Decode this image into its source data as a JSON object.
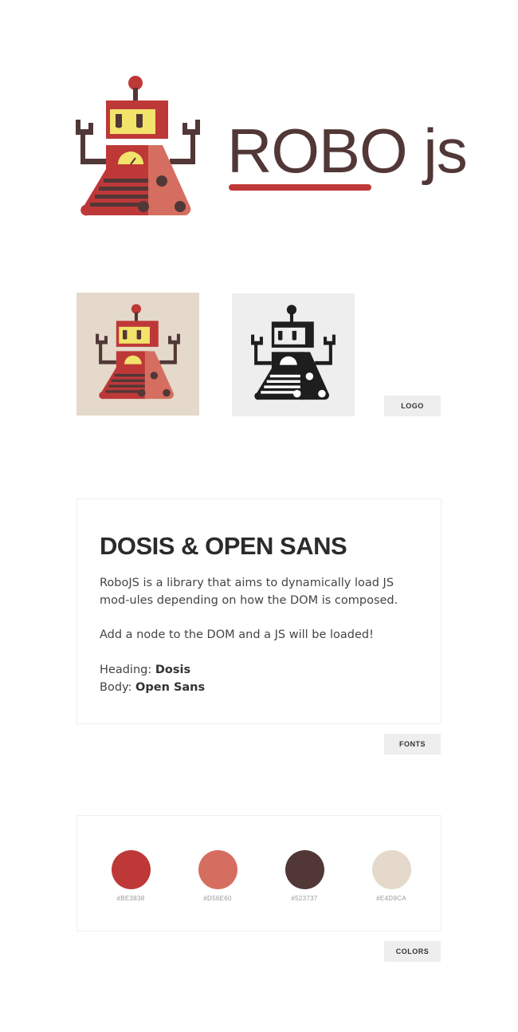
{
  "hero": {
    "wordmark": "ROBO js"
  },
  "labels": {
    "logo": "LOGO",
    "fonts": "FONTS",
    "colors": "COLORS"
  },
  "fonts": {
    "heading": "DOSIS & OPEN SANS",
    "paragraph1": "RoboJS is a library that aims to dynamically load JS mod-ules depending on how the DOM is composed.",
    "paragraph2": "Add a node to the DOM and a JS will be loaded!",
    "heading_label": "Heading:",
    "heading_value": "Dosis",
    "body_label": "Body:",
    "body_value": "Open Sans"
  },
  "colors": [
    {
      "hex": "#BE3838",
      "label": "#BE3838"
    },
    {
      "hex": "#D56E60",
      "label": "#D56E60"
    },
    {
      "hex": "#523737",
      "label": "#523737"
    },
    {
      "hex": "#E4D9CA",
      "label": "#E4D9CA"
    }
  ],
  "icons": {
    "hero": "robot-logo-icon",
    "color_variant": "robot-logo-color-icon",
    "mono_variant": "robot-logo-mono-icon"
  }
}
